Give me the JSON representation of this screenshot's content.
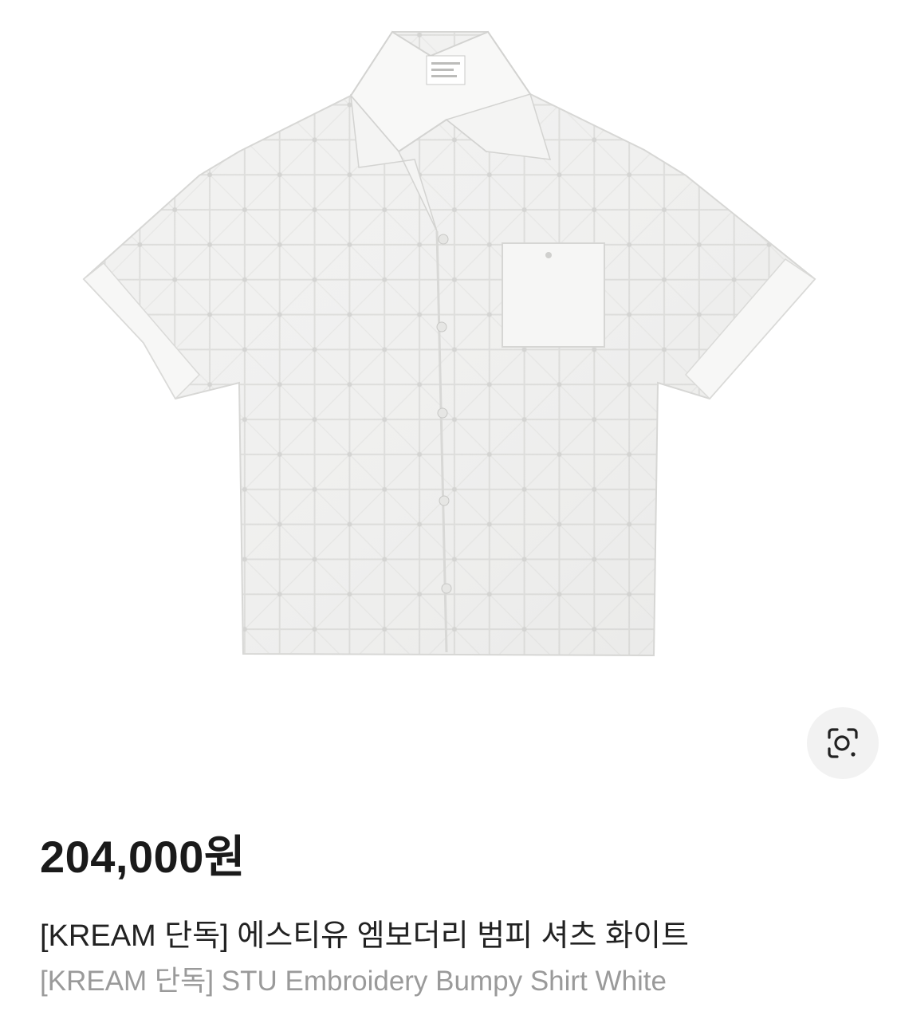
{
  "product": {
    "image_alt": "STU Embroidery Bumpy Shirt White product photo",
    "price": "204,000원",
    "title_ko": "[KREAM 단독] 에스티유 엠보더리 범피 셔츠 화이트",
    "title_en": "[KREAM 단독] STU Embroidery Bumpy Shirt White"
  },
  "actions": {
    "lens_icon": "lens-search-icon"
  },
  "colors": {
    "price_text": "#1a1a1a",
    "title_ko_text": "#222222",
    "title_en_text": "#9a9a9a",
    "lens_bg": "#f2f2f2"
  }
}
